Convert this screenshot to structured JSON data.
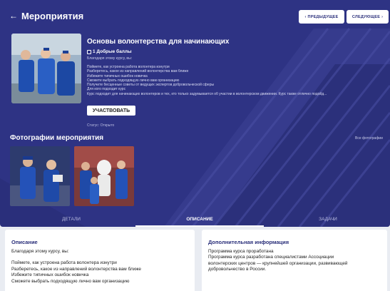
{
  "header": {
    "back_icon": "arrow-left-icon",
    "title": "Мероприятия",
    "prev_label": "ПРЕДЫДУЩЕЕ",
    "next_label": "СЛЕДУЮЩЕЕ",
    "prev_icon": "chevron-left-icon",
    "next_icon": "chevron-right-icon"
  },
  "course": {
    "title": "Основы волонтерства для начинающих",
    "points": "1 Добрые баллы",
    "points_icon": "bookmark-icon",
    "lead": "Благодаря этому курсу, вы:",
    "items": [
      "Поймете, как устроена работа волонтера изнутри",
      "Разберетесь, какое из направлений волонтерства вам ближе",
      "Избежите типичных ошибок новичка",
      "Сможете выбрать подходящую лично вам организацию",
      "Получите бесценные советы от ведущих экспертов добровольческой сферы",
      "Для кого подходит курс",
      "Курс подходит для начинающих волонтеров и тех, кто только задумывается об участии в волонтерском движении. Курс также отлично подойд..."
    ],
    "participate_label": "УЧАСТВОВАТЬ",
    "status": "Статус: Открыто"
  },
  "photos": {
    "title": "Фотографии мероприятия",
    "all_label": "Все фотографии"
  },
  "tabs": [
    "ДЕТАЛИ",
    "ОПИСАНИЕ",
    "ЗАДАЧИ"
  ],
  "description": {
    "title": "Описание",
    "lead": "Благодаря этому курсу, вы:",
    "items": [
      "Поймете, как устроена работа волонтера изнутри",
      "Разберетесь, какое из направлений волонтерства вам ближе",
      "Избежите типичных ошибок новичка",
      "Сможете выбрать подходящую лично вам организацию"
    ]
  },
  "additional": {
    "title": "Дополнительная информация",
    "lines": [
      "Программа курса проработана",
      "Программа курса разработана специалистами Ассоциации",
      "волонтерских центров — крупнейшей организации, развивающей",
      "добровольчество в России."
    ]
  },
  "colors": {
    "hero_bg": "#2e3384",
    "accent": "#2a2f7a"
  }
}
